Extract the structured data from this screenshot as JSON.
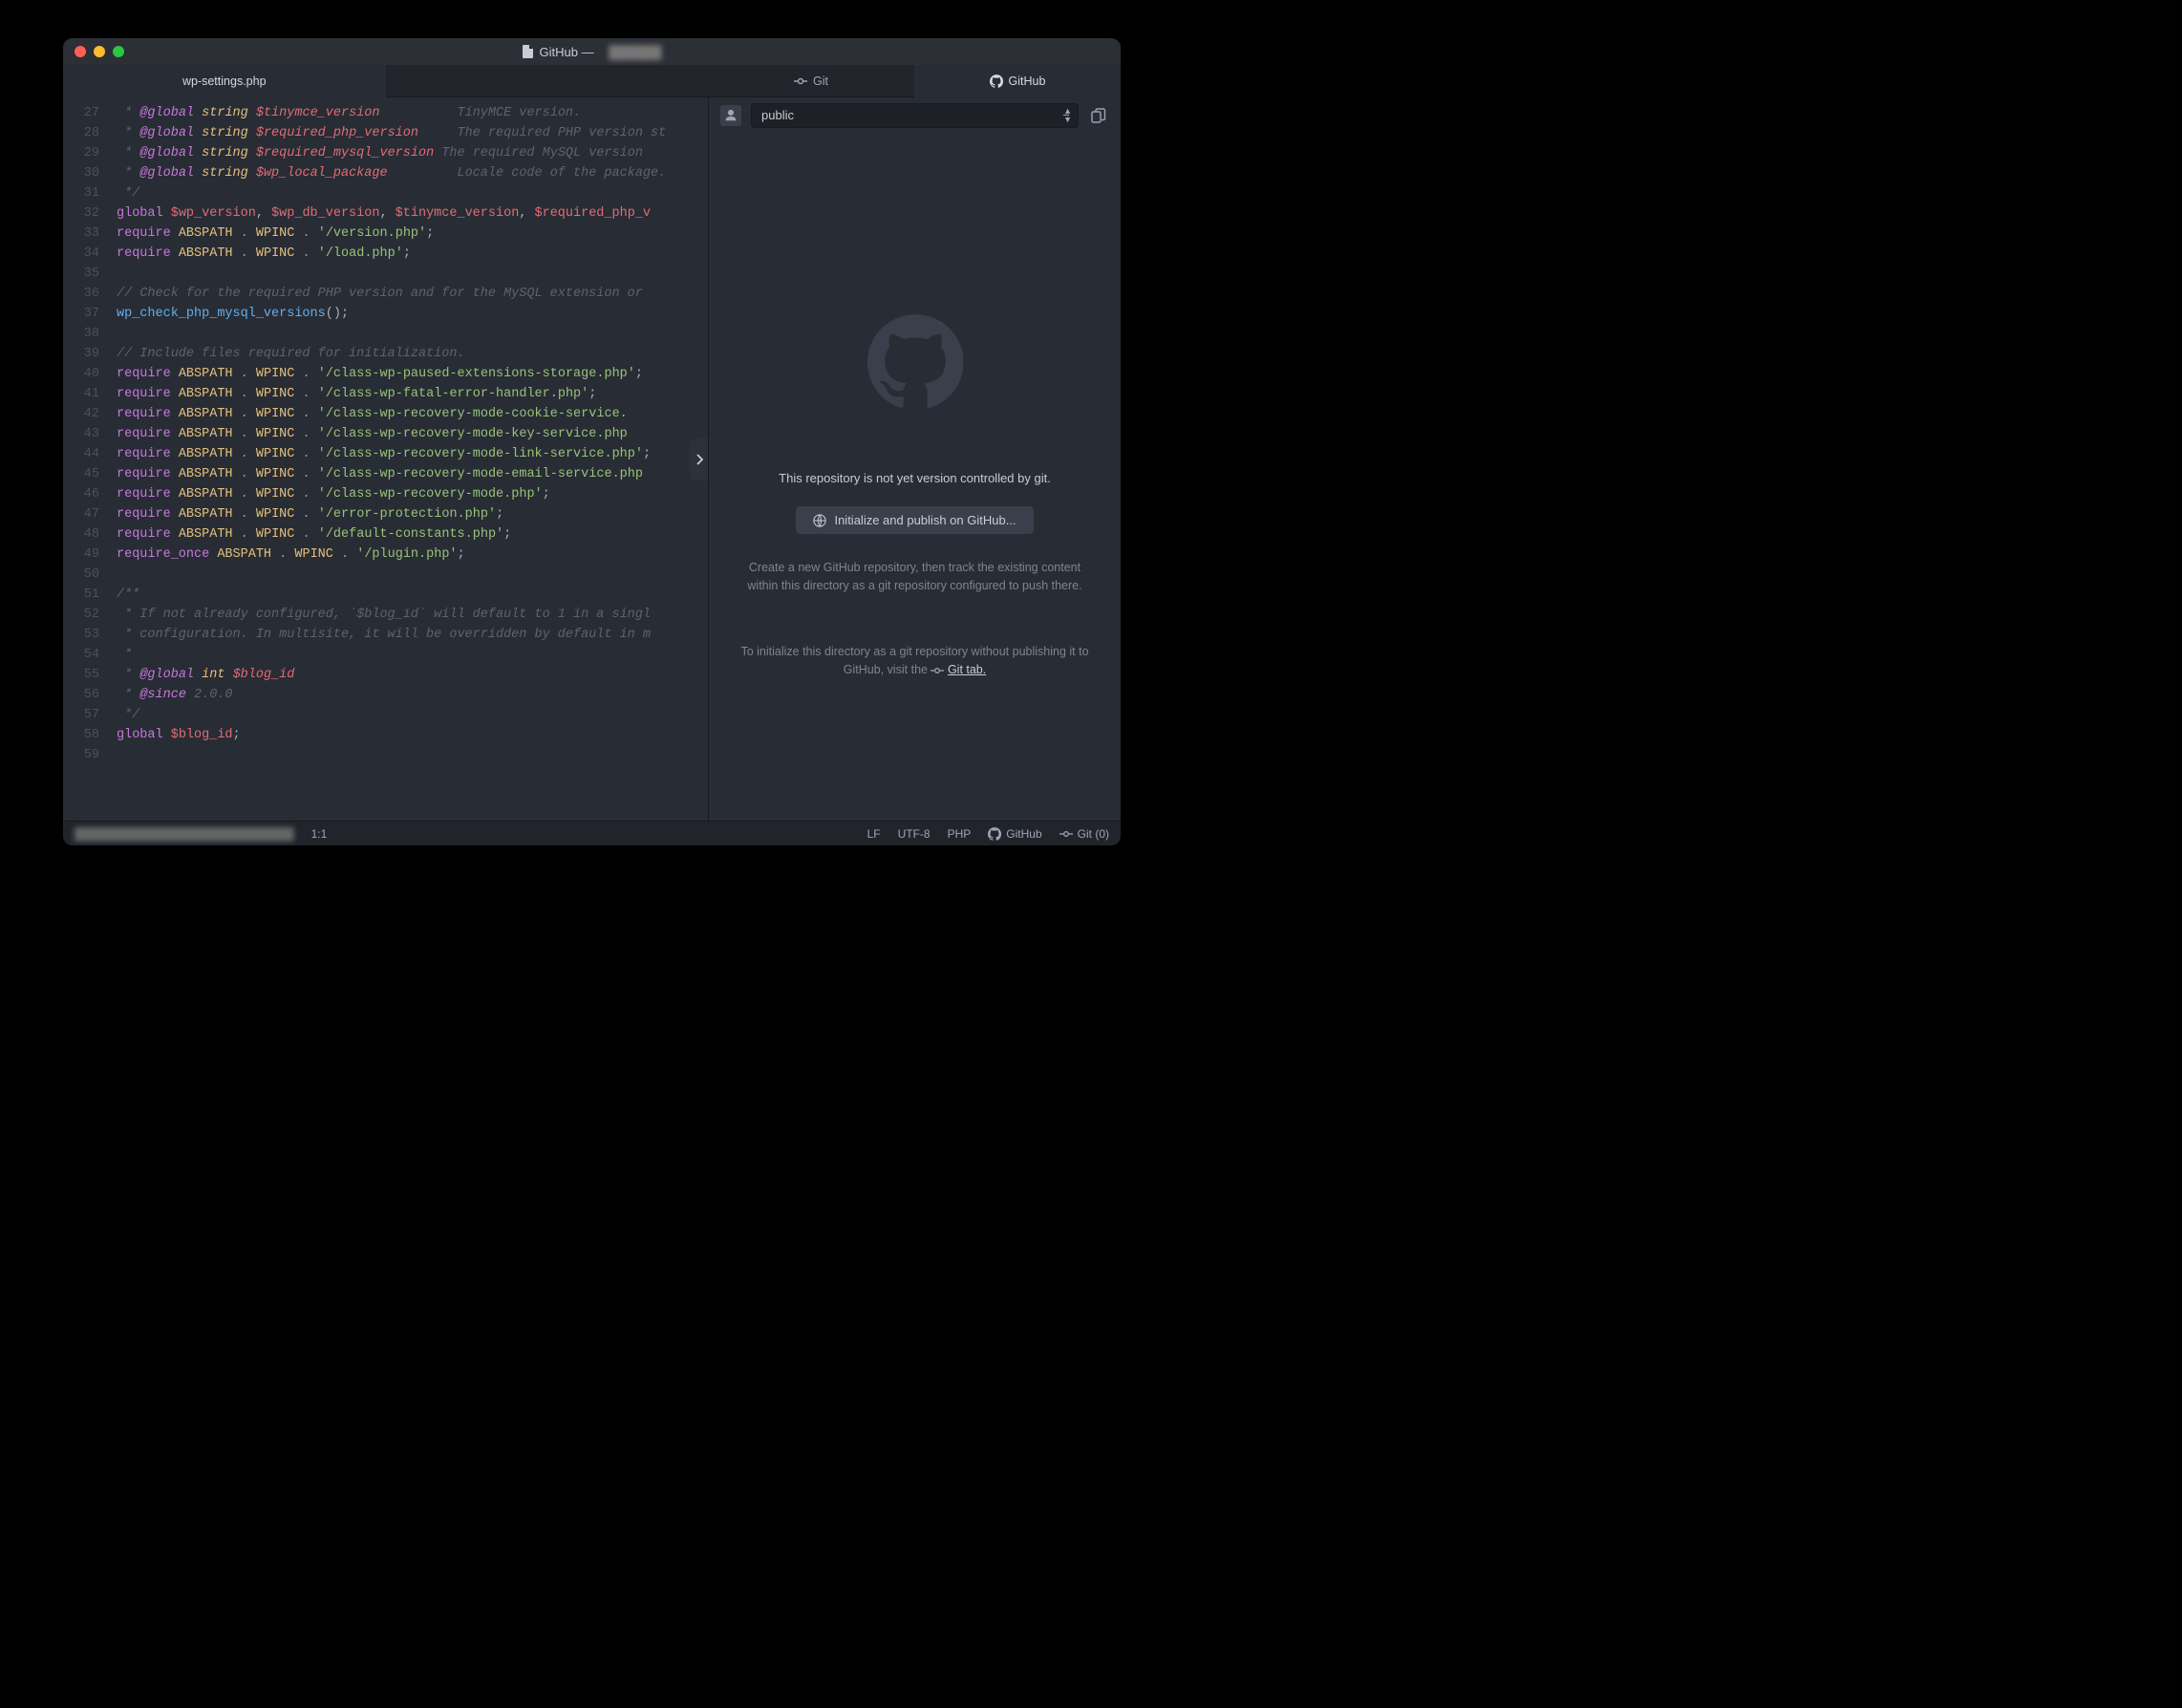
{
  "window": {
    "title_prefix": "GitHub —",
    "title_secret": "██████"
  },
  "tabs": {
    "editor_active": "wp-settings.php",
    "side_git": "Git",
    "side_github": "GitHub"
  },
  "gutter_start": 27,
  "gutter_end": 59,
  "code_lines": [
    [
      [
        "c-comment",
        " * "
      ],
      [
        "c-tag",
        "@global"
      ],
      [
        "c-comment",
        " "
      ],
      [
        "c-type",
        "string"
      ],
      [
        "c-comment",
        " "
      ],
      [
        "c-var",
        "$tinymce_version"
      ],
      [
        "c-comment",
        "          TinyMCE version."
      ]
    ],
    [
      [
        "c-comment",
        " * "
      ],
      [
        "c-tag",
        "@global"
      ],
      [
        "c-comment",
        " "
      ],
      [
        "c-type",
        "string"
      ],
      [
        "c-comment",
        " "
      ],
      [
        "c-var",
        "$required_php_version"
      ],
      [
        "c-comment",
        "     The required PHP version st"
      ]
    ],
    [
      [
        "c-comment",
        " * "
      ],
      [
        "c-tag",
        "@global"
      ],
      [
        "c-comment",
        " "
      ],
      [
        "c-type",
        "string"
      ],
      [
        "c-comment",
        " "
      ],
      [
        "c-var",
        "$required_mysql_version"
      ],
      [
        "c-comment",
        " The required MySQL version "
      ]
    ],
    [
      [
        "c-comment",
        " * "
      ],
      [
        "c-tag",
        "@global"
      ],
      [
        "c-comment",
        " "
      ],
      [
        "c-type",
        "string"
      ],
      [
        "c-comment",
        " "
      ],
      [
        "c-var",
        "$wp_local_package"
      ],
      [
        "c-comment",
        "         Locale code of the package."
      ]
    ],
    [
      [
        "c-comment",
        " */"
      ]
    ],
    [
      [
        "c-kw",
        "global"
      ],
      [
        "",
        " "
      ],
      [
        "c-gvar",
        "$wp_version"
      ],
      [
        "",
        ", "
      ],
      [
        "c-gvar",
        "$wp_db_version"
      ],
      [
        "",
        ", "
      ],
      [
        "c-gvar",
        "$tinymce_version"
      ],
      [
        "",
        ", "
      ],
      [
        "c-gvar",
        "$required_php_v"
      ]
    ],
    [
      [
        "c-kw",
        "require"
      ],
      [
        "",
        " "
      ],
      [
        "c-const",
        "ABSPATH"
      ],
      [
        "",
        " "
      ],
      [
        "c-op",
        "."
      ],
      [
        "",
        " "
      ],
      [
        "c-const",
        "WPINC"
      ],
      [
        "",
        " "
      ],
      [
        "c-op",
        "."
      ],
      [
        "",
        " "
      ],
      [
        "c-str",
        "'/version.php'"
      ],
      [
        "",
        ";"
      ]
    ],
    [
      [
        "c-kw",
        "require"
      ],
      [
        "",
        " "
      ],
      [
        "c-const",
        "ABSPATH"
      ],
      [
        "",
        " "
      ],
      [
        "c-op",
        "."
      ],
      [
        "",
        " "
      ],
      [
        "c-const",
        "WPINC"
      ],
      [
        "",
        " "
      ],
      [
        "c-op",
        "."
      ],
      [
        "",
        " "
      ],
      [
        "c-str",
        "'/load.php'"
      ],
      [
        "",
        ";"
      ]
    ],
    [
      [
        "",
        ""
      ]
    ],
    [
      [
        "c-comment",
        "// Check for the required PHP version and for the MySQL extension or "
      ]
    ],
    [
      [
        "c-fn",
        "wp_check_php_mysql_versions"
      ],
      [
        "",
        "();"
      ]
    ],
    [
      [
        "",
        ""
      ]
    ],
    [
      [
        "c-comment",
        "// Include files required for initialization."
      ]
    ],
    [
      [
        "c-kw",
        "require"
      ],
      [
        "",
        " "
      ],
      [
        "c-const",
        "ABSPATH"
      ],
      [
        "",
        " "
      ],
      [
        "c-op",
        "."
      ],
      [
        "",
        " "
      ],
      [
        "c-const",
        "WPINC"
      ],
      [
        "",
        " "
      ],
      [
        "c-op",
        "."
      ],
      [
        "",
        " "
      ],
      [
        "c-str",
        "'/class-wp-paused-extensions-storage.php'"
      ],
      [
        "",
        ";"
      ]
    ],
    [
      [
        "c-kw",
        "require"
      ],
      [
        "",
        " "
      ],
      [
        "c-const",
        "ABSPATH"
      ],
      [
        "",
        " "
      ],
      [
        "c-op",
        "."
      ],
      [
        "",
        " "
      ],
      [
        "c-const",
        "WPINC"
      ],
      [
        "",
        " "
      ],
      [
        "c-op",
        "."
      ],
      [
        "",
        " "
      ],
      [
        "c-str",
        "'/class-wp-fatal-error-handler.php'"
      ],
      [
        "",
        ";"
      ]
    ],
    [
      [
        "c-kw",
        "require"
      ],
      [
        "",
        " "
      ],
      [
        "c-const",
        "ABSPATH"
      ],
      [
        "",
        " "
      ],
      [
        "c-op",
        "."
      ],
      [
        "",
        " "
      ],
      [
        "c-const",
        "WPINC"
      ],
      [
        "",
        " "
      ],
      [
        "c-op",
        "."
      ],
      [
        "",
        " "
      ],
      [
        "c-str",
        "'/class-wp-recovery-mode-cookie-service."
      ]
    ],
    [
      [
        "c-kw",
        "require"
      ],
      [
        "",
        " "
      ],
      [
        "c-const",
        "ABSPATH"
      ],
      [
        "",
        " "
      ],
      [
        "c-op",
        "."
      ],
      [
        "",
        " "
      ],
      [
        "c-const",
        "WPINC"
      ],
      [
        "",
        " "
      ],
      [
        "c-op",
        "."
      ],
      [
        "",
        " "
      ],
      [
        "c-str",
        "'/class-wp-recovery-mode-key-service.php"
      ]
    ],
    [
      [
        "c-kw",
        "require"
      ],
      [
        "",
        " "
      ],
      [
        "c-const",
        "ABSPATH"
      ],
      [
        "",
        " "
      ],
      [
        "c-op",
        "."
      ],
      [
        "",
        " "
      ],
      [
        "c-const",
        "WPINC"
      ],
      [
        "",
        " "
      ],
      [
        "c-op",
        "."
      ],
      [
        "",
        " "
      ],
      [
        "c-str",
        "'/class-wp-recovery-mode-link-service.php'"
      ],
      [
        "",
        ";"
      ]
    ],
    [
      [
        "c-kw",
        "require"
      ],
      [
        "",
        " "
      ],
      [
        "c-const",
        "ABSPATH"
      ],
      [
        "",
        " "
      ],
      [
        "c-op",
        "."
      ],
      [
        "",
        " "
      ],
      [
        "c-const",
        "WPINC"
      ],
      [
        "",
        " "
      ],
      [
        "c-op",
        "."
      ],
      [
        "",
        " "
      ],
      [
        "c-str",
        "'/class-wp-recovery-mode-email-service.php"
      ]
    ],
    [
      [
        "c-kw",
        "require"
      ],
      [
        "",
        " "
      ],
      [
        "c-const",
        "ABSPATH"
      ],
      [
        "",
        " "
      ],
      [
        "c-op",
        "."
      ],
      [
        "",
        " "
      ],
      [
        "c-const",
        "WPINC"
      ],
      [
        "",
        " "
      ],
      [
        "c-op",
        "."
      ],
      [
        "",
        " "
      ],
      [
        "c-str",
        "'/class-wp-recovery-mode.php'"
      ],
      [
        "",
        ";"
      ]
    ],
    [
      [
        "c-kw",
        "require"
      ],
      [
        "",
        " "
      ],
      [
        "c-const",
        "ABSPATH"
      ],
      [
        "",
        " "
      ],
      [
        "c-op",
        "."
      ],
      [
        "",
        " "
      ],
      [
        "c-const",
        "WPINC"
      ],
      [
        "",
        " "
      ],
      [
        "c-op",
        "."
      ],
      [
        "",
        " "
      ],
      [
        "c-str",
        "'/error-protection.php'"
      ],
      [
        "",
        ";"
      ]
    ],
    [
      [
        "c-kw",
        "require"
      ],
      [
        "",
        " "
      ],
      [
        "c-const",
        "ABSPATH"
      ],
      [
        "",
        " "
      ],
      [
        "c-op",
        "."
      ],
      [
        "",
        " "
      ],
      [
        "c-const",
        "WPINC"
      ],
      [
        "",
        " "
      ],
      [
        "c-op",
        "."
      ],
      [
        "",
        " "
      ],
      [
        "c-str",
        "'/default-constants.php'"
      ],
      [
        "",
        ";"
      ]
    ],
    [
      [
        "c-kw",
        "require_once"
      ],
      [
        "",
        " "
      ],
      [
        "c-const",
        "ABSPATH"
      ],
      [
        "",
        " "
      ],
      [
        "c-op",
        "."
      ],
      [
        "",
        " "
      ],
      [
        "c-const",
        "WPINC"
      ],
      [
        "",
        " "
      ],
      [
        "c-op",
        "."
      ],
      [
        "",
        " "
      ],
      [
        "c-str",
        "'/plugin.php'"
      ],
      [
        "",
        ";"
      ]
    ],
    [
      [
        "",
        ""
      ]
    ],
    [
      [
        "c-comment",
        "/**"
      ]
    ],
    [
      [
        "c-comment",
        " * If not already configured, `$blog_id` will default to 1 in a singl"
      ]
    ],
    [
      [
        "c-comment",
        " * configuration. In multisite, it will be overridden by default in m"
      ]
    ],
    [
      [
        "c-comment",
        " *"
      ]
    ],
    [
      [
        "c-comment",
        " * "
      ],
      [
        "c-tag",
        "@global"
      ],
      [
        "c-comment",
        " "
      ],
      [
        "c-type",
        "int"
      ],
      [
        "c-comment",
        " "
      ],
      [
        "c-var",
        "$blog_id"
      ]
    ],
    [
      [
        "c-comment",
        " * "
      ],
      [
        "c-tag",
        "@since"
      ],
      [
        "c-comment",
        " 2.0.0"
      ]
    ],
    [
      [
        "c-comment",
        " */"
      ]
    ],
    [
      [
        "c-kw",
        "global"
      ],
      [
        "",
        " "
      ],
      [
        "c-gvar",
        "$blog_id"
      ],
      [
        "",
        ";"
      ]
    ],
    [
      [
        "",
        ""
      ]
    ]
  ],
  "side": {
    "selector": "public",
    "msg": "This repository is not yet version controlled by git.",
    "button": "Initialize and publish on GitHub...",
    "desc": "Create a new GitHub repository, then track the existing content within this directory as a git repository configured to push there.",
    "desc2_a": "To initialize this directory as a git repository without publishing it to GitHub, visit the ",
    "desc2_link": "Git tab."
  },
  "status": {
    "cursor": "1:1",
    "eol": "LF",
    "encoding": "UTF-8",
    "lang": "PHP",
    "github": "GitHub",
    "git": "Git (0)"
  }
}
